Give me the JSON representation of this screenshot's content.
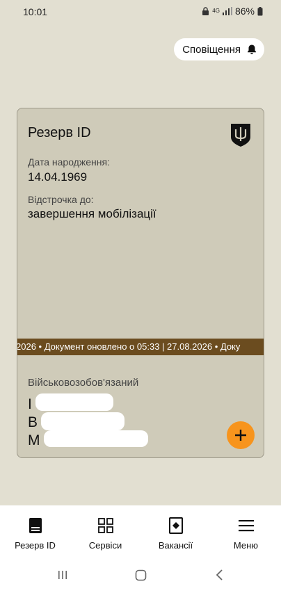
{
  "status_bar": {
    "time": "10:01",
    "network": "4G",
    "battery": "86%"
  },
  "header": {
    "notifications_label": "Сповіщення"
  },
  "card": {
    "title": "Резерв ID",
    "birth_date_label": "Дата народження:",
    "birth_date": "14.04.1969",
    "deferral_label": "Відстрочка до:",
    "deferral_value": "завершення мобілізації",
    "ticker_text": "2026 • Документ оновлено о 05:33 | 27.08.2026 • Доку",
    "status": "Військовозобов'язаний",
    "name_line_1": "І",
    "name_line_2": "В                     ир",
    "name_line_3": "М"
  },
  "bottom_nav": {
    "items": [
      {
        "label": "Резерв ID",
        "icon": "document-icon"
      },
      {
        "label": "Сервіси",
        "icon": "grid-icon"
      },
      {
        "label": "Вакансії",
        "icon": "vacancy-icon"
      },
      {
        "label": "Меню",
        "icon": "menu-icon"
      }
    ]
  },
  "colors": {
    "background": "#e2dfd1",
    "card": "#cfcbb9",
    "ticker": "#6b4c1f",
    "accent": "#f7941d"
  }
}
